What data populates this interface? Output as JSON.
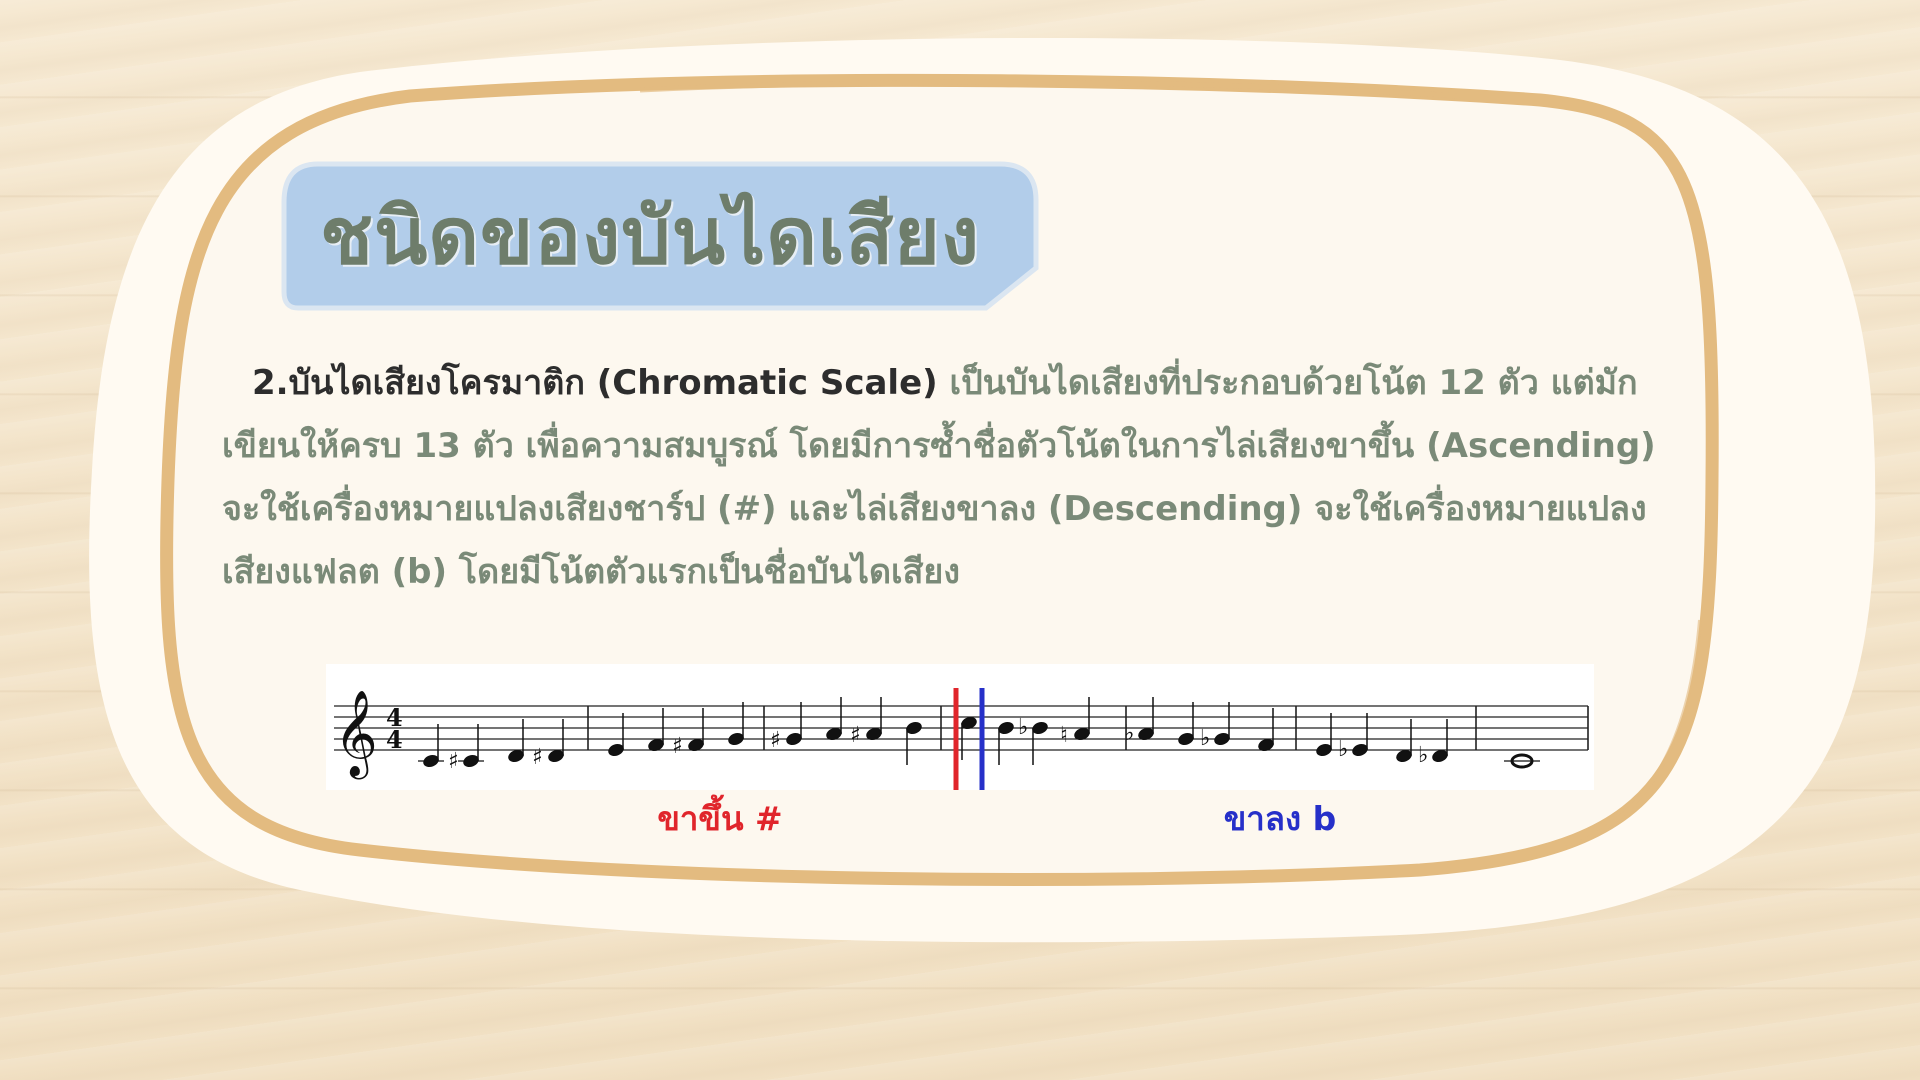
{
  "slide": {
    "title": "ชนิดของบันไดเสียง",
    "paragraph": {
      "lead": "2.บันไดเสียงโครมาติก (Chromatic Scale)",
      "rest": " เป็นบันไดเสียงที่ประกอบด้วยโน้ต 12 ตัว แต่มักเขียนให้ครบ 13 ตัว เพื่อความสมบูรณ์ โดยมีการซ้ำชื่อตัวโน้ตในการไล่เสียงขาขึ้น (Ascending) จะใช้เครื่องหมายแปลงเสียงชาร์ป (#) และไล่เสียงขาลง (Descending) จะใช้เครื่องหมายแปลงเสียงแฟลต (b) โดยมีโน้ตตัวแรกเป็นชื่อบันไดเสียง"
    },
    "labels": {
      "ascending": "ขาขึ้น #",
      "descending": "ขาลง b"
    },
    "notation": {
      "time_signature": "4/4",
      "clef": "treble",
      "ascending_notes": [
        "C",
        "C#",
        "D",
        "D#",
        "E",
        "F",
        "F#",
        "G",
        "G#",
        "A",
        "A#",
        "B",
        "C"
      ],
      "descending_notes": [
        "C",
        "B",
        "Bb",
        "A",
        "Ab",
        "G",
        "Gb",
        "F",
        "E",
        "Eb",
        "D",
        "Db",
        "C"
      ],
      "colors": {
        "ascending_marker": "#e0252b",
        "descending_marker": "#2630c9"
      }
    },
    "colors": {
      "title_fill": "#b2cdea",
      "title_text": "#6e7d6b",
      "frame_ring": "#e3bb80",
      "card": "#fdf8ef",
      "body_text": "#7a8a78",
      "lead_text": "#2d2d2d"
    }
  }
}
